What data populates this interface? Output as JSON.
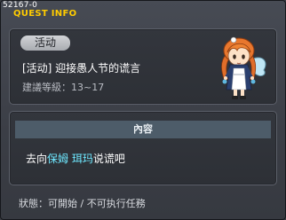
{
  "header": {
    "quest_id": "52167-0",
    "title": "QUEST INFO"
  },
  "quest": {
    "tag": "活动",
    "name": "[活动] 迎接愚人节的谎言",
    "level": "建議等級：13~17"
  },
  "content": {
    "heading": "內容",
    "text_prefix": "去向",
    "npc_role": "保姆",
    "npc_name": "珥玛",
    "text_suffix": "说谎吧"
  },
  "status": {
    "text": "狀態：可開始 / 不可执行任務"
  },
  "colors": {
    "title": "#ffcc00",
    "highlight": "#6ee8ff",
    "content_bar": "#4d5c69"
  }
}
